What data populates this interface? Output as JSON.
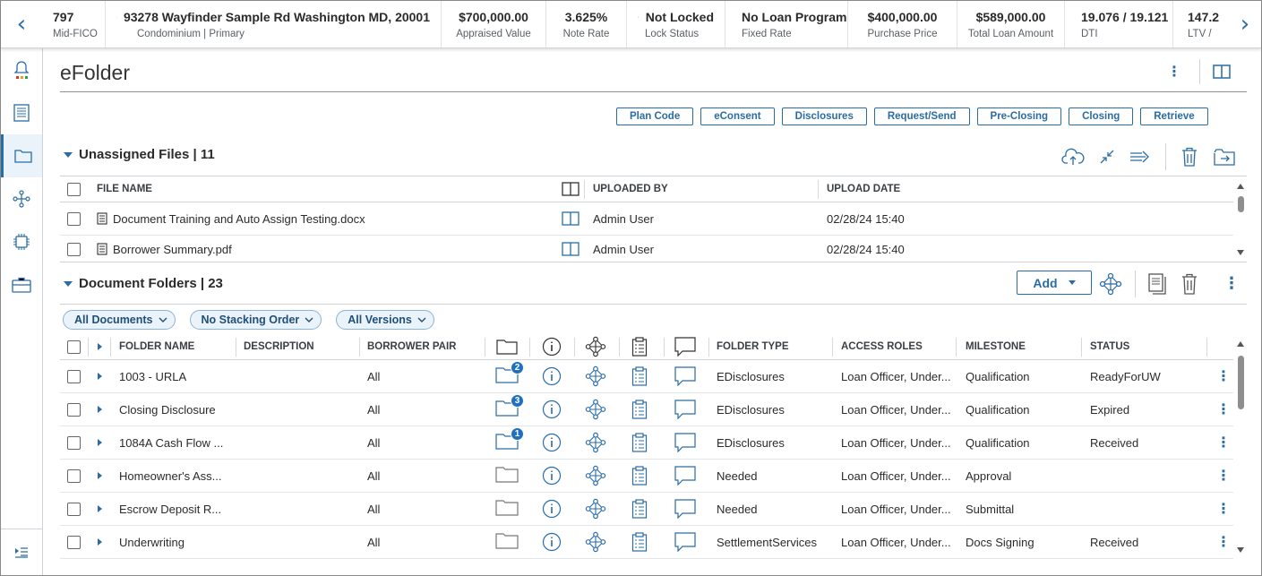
{
  "header": {
    "fico": {
      "value": "797",
      "label": "Mid-FICO"
    },
    "address": {
      "value": "93278 Wayfinder Sample Rd Washington MD, 20001",
      "label": "Condominium | Primary"
    },
    "appraised": {
      "value": "$700,000.00",
      "label": "Appraised Value"
    },
    "note_rate": {
      "value": "3.625%",
      "label": "Note Rate"
    },
    "lock": {
      "value": "Not Locked",
      "label": "Lock Status"
    },
    "loan_program": {
      "value": "No Loan Program",
      "label": "Fixed Rate"
    },
    "purchase": {
      "value": "$400,000.00",
      "label": "Purchase Price"
    },
    "total_loan": {
      "value": "$589,000.00",
      "label": "Total Loan Amount"
    },
    "dti": {
      "value": "19.076 / 19.121",
      "label": "DTI"
    },
    "ltv": {
      "value": "147.2",
      "label": "LTV /"
    }
  },
  "page": {
    "title": "eFolder"
  },
  "actions": [
    "Plan Code",
    "eConsent",
    "Disclosures",
    "Request/Send",
    "Pre-Closing",
    "Closing",
    "Retrieve"
  ],
  "unassigned": {
    "title": "Unassigned Files | 11",
    "columns": {
      "file_name": "FILE NAME",
      "uploaded_by": "UPLOADED BY",
      "upload_date": "UPLOAD DATE"
    },
    "rows": [
      {
        "file": "Document Training and Auto Assign Testing.docx",
        "by": "Admin User",
        "date": "02/28/24 15:40"
      },
      {
        "file": "Borrower Summary.pdf",
        "by": "Admin User",
        "date": "02/28/24 15:40"
      }
    ]
  },
  "folders": {
    "title": "Document Folders | 23",
    "add_label": "Add",
    "filters": [
      "All Documents",
      "No Stacking Order",
      "All Versions"
    ],
    "columns": {
      "folder_name": "FOLDER NAME",
      "description": "DESCRIPTION",
      "borrower_pair": "BORROWER PAIR",
      "folder_type": "FOLDER TYPE",
      "access_roles": "ACCESS ROLES",
      "milestone": "MILESTONE",
      "status": "STATUS"
    },
    "rows": [
      {
        "name": "1003 - URLA",
        "desc": "",
        "pair": "All",
        "count": "2",
        "type": "EDisclosures",
        "roles": "Loan Officer, Under...",
        "milestone": "Qualification",
        "status": "ReadyForUW"
      },
      {
        "name": "Closing Disclosure",
        "desc": "",
        "pair": "All",
        "count": "3",
        "type": "EDisclosures",
        "roles": "Loan Officer, Under...",
        "milestone": "Qualification",
        "status": "Expired"
      },
      {
        "name": "1084A Cash Flow ...",
        "desc": "",
        "pair": "All",
        "count": "1",
        "type": "EDisclosures",
        "roles": "Loan Officer, Under...",
        "milestone": "Qualification",
        "status": "Received"
      },
      {
        "name": "Homeowner's Ass...",
        "desc": "",
        "pair": "All",
        "count": "",
        "type": "Needed",
        "roles": "Loan Officer, Under...",
        "milestone": "Approval",
        "status": ""
      },
      {
        "name": "Escrow Deposit R...",
        "desc": "",
        "pair": "All",
        "count": "",
        "type": "Needed",
        "roles": "Loan Officer, Under...",
        "milestone": "Submittal",
        "status": ""
      },
      {
        "name": "Underwriting",
        "desc": "",
        "pair": "All",
        "count": "",
        "type": "SettlementServices",
        "roles": "Loan Officer, Under...",
        "milestone": "Docs Signing",
        "status": "Received"
      }
    ]
  }
}
